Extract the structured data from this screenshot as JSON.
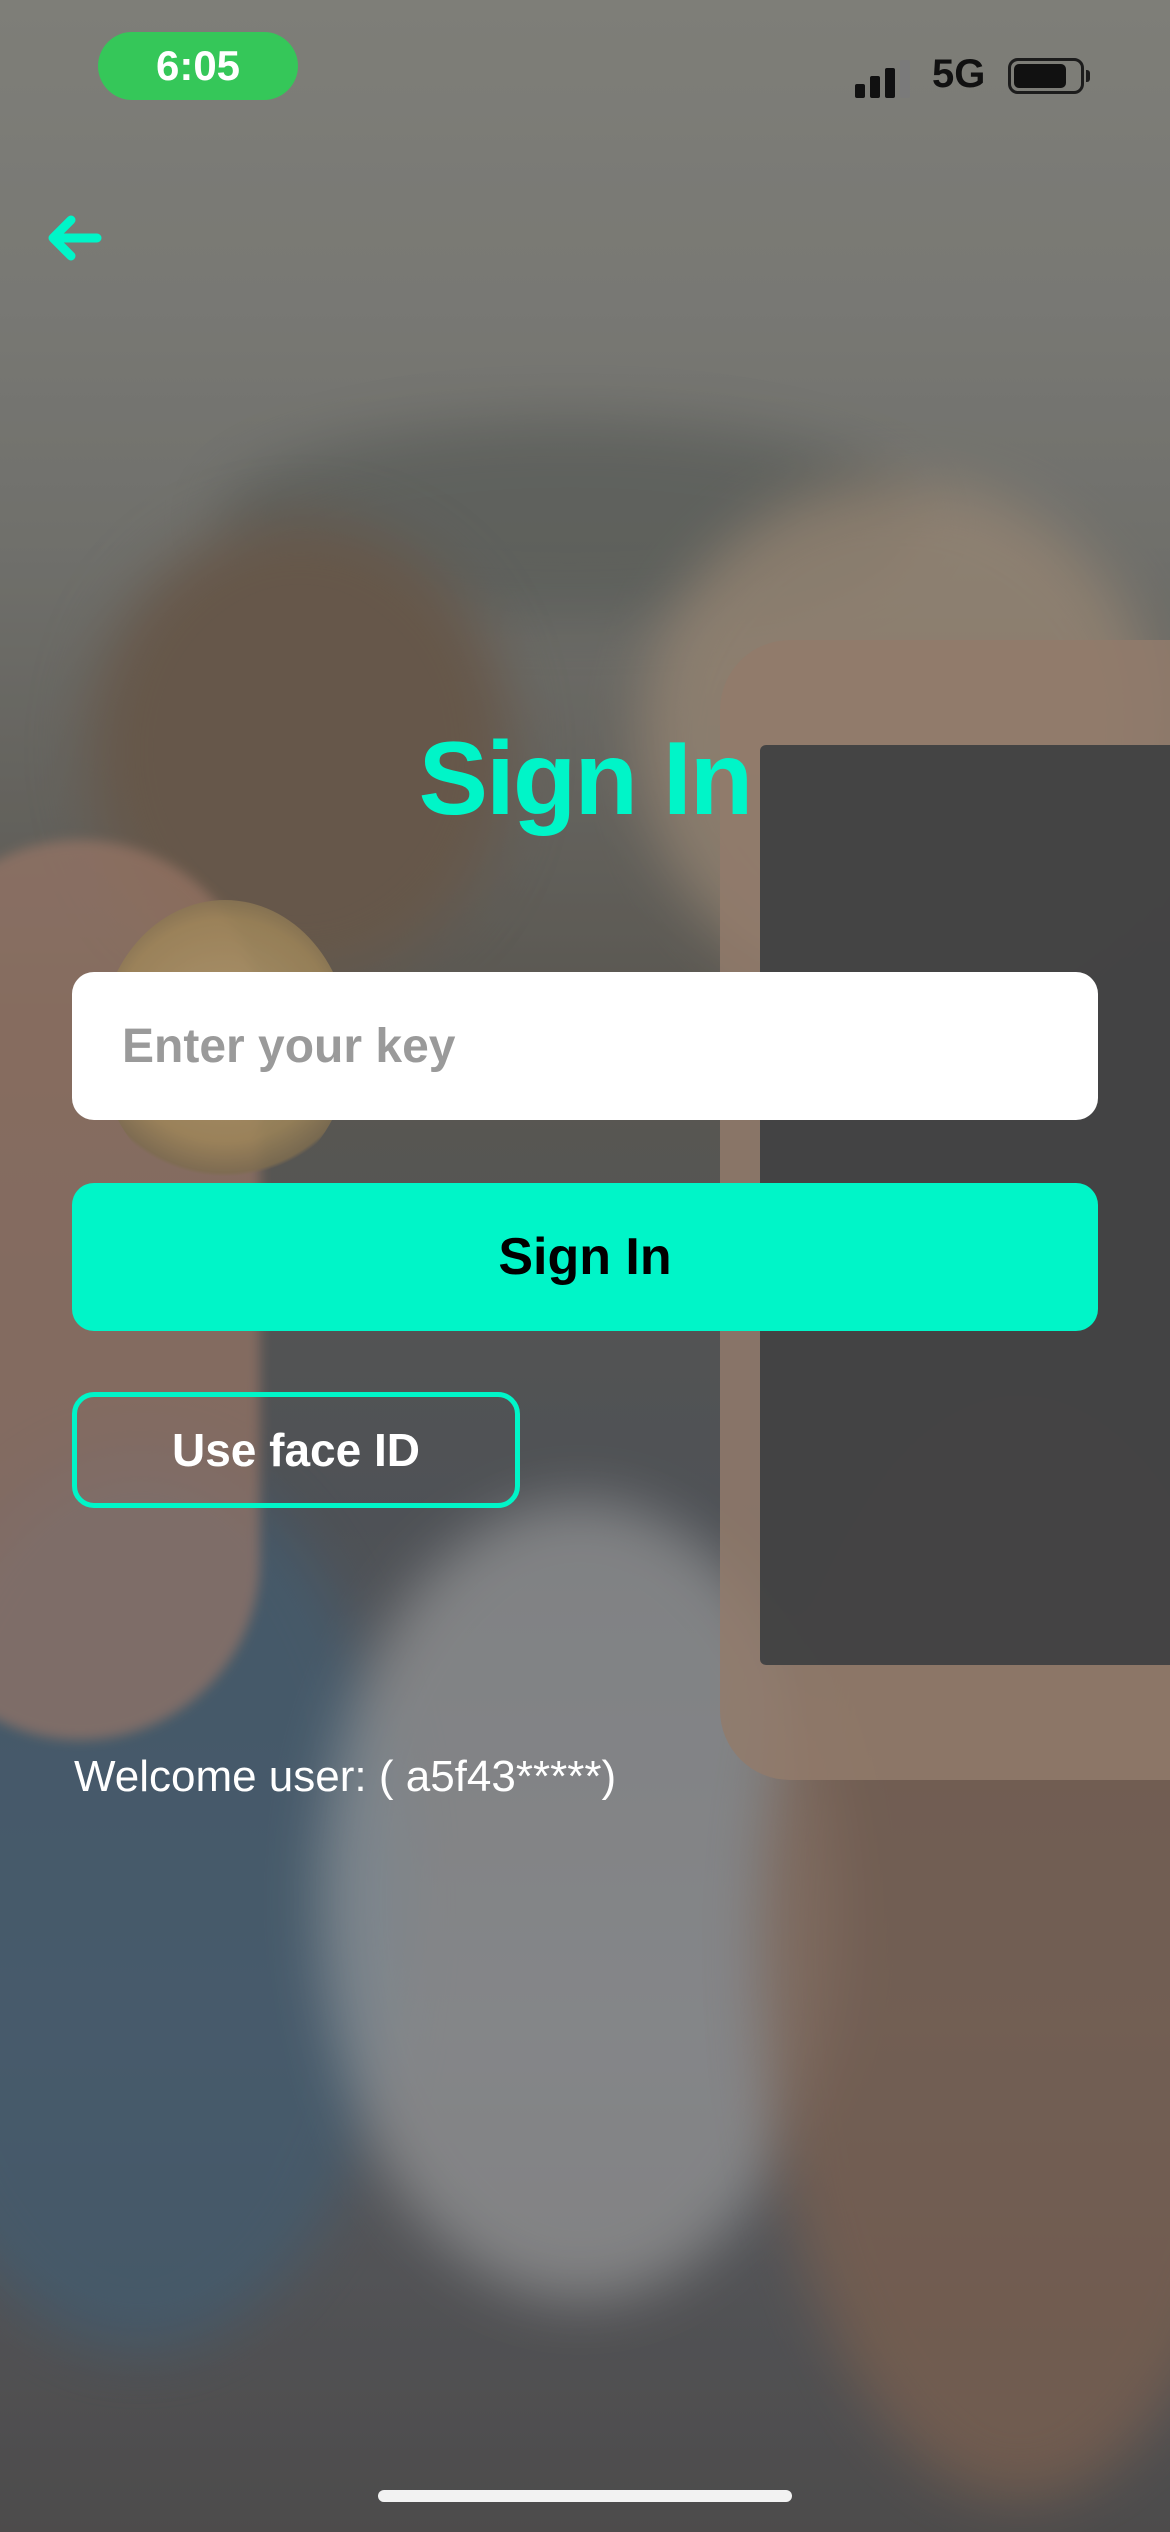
{
  "status_bar": {
    "time": "6:05",
    "network": "5G"
  },
  "header": {
    "back_icon": "arrow-left-icon"
  },
  "main": {
    "title": "Sign In",
    "key_input": {
      "placeholder": "Enter your key",
      "value": ""
    },
    "signin_button_label": "Sign In",
    "faceid_button_label": "Use face ID",
    "welcome_text": "Welcome user: ( a5f43*****)"
  },
  "colors": {
    "accent": "#00f5c8",
    "time_pill": "#35c759",
    "button_text": "#000000",
    "text_light": "#ffffff"
  }
}
